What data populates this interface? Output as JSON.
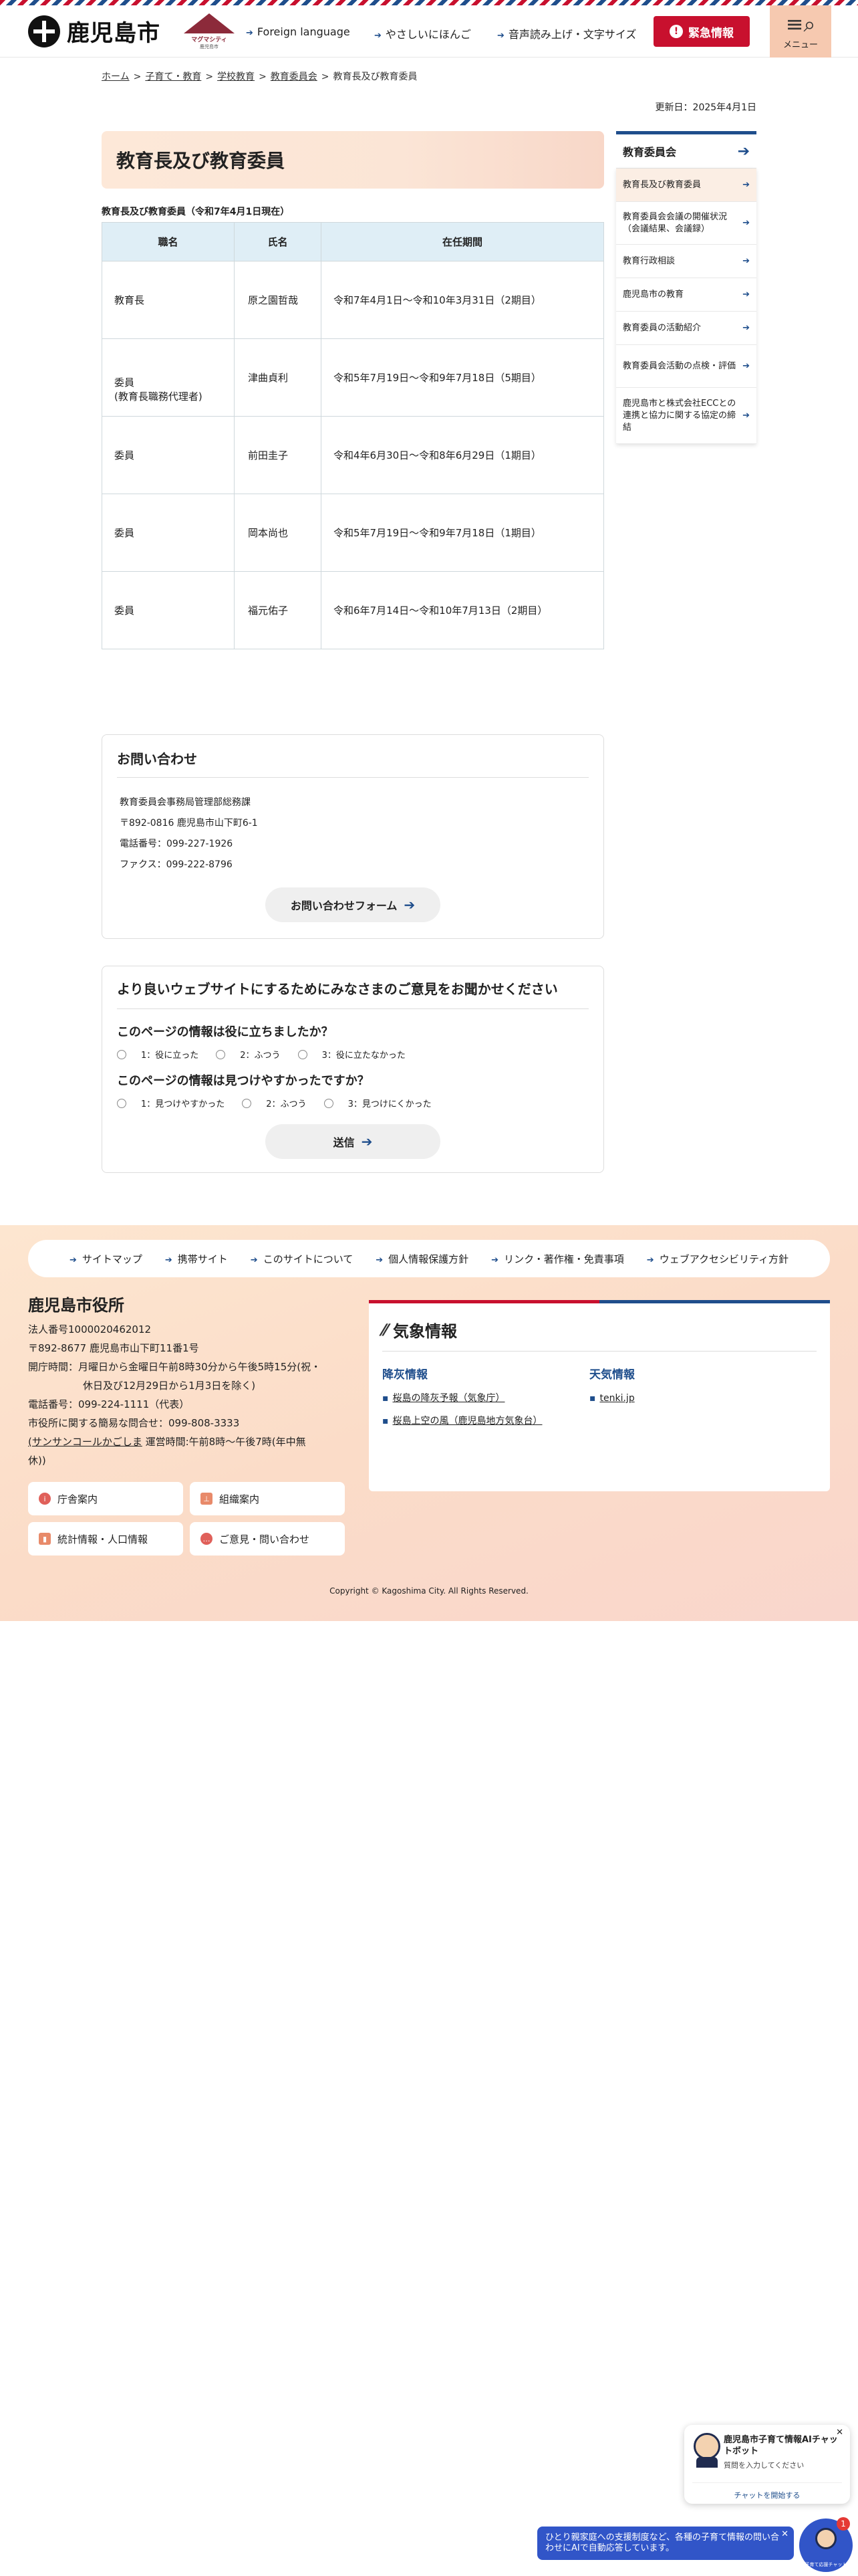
{
  "header": {
    "logo_text": "鹿児島市",
    "magma_text": "マグマシティ",
    "magma_sub": "鹿児島市",
    "nav": [
      "Foreign language",
      "やさしいにほんご",
      "音声読み上げ・文字サイズ"
    ],
    "emergency_label": "緊急情報",
    "menu_label": "メニュー"
  },
  "breadcrumb": [
    "ホーム",
    "子育て・教育",
    "学校教育",
    "教育委員会",
    "教育長及び教育委員"
  ],
  "updated": "更新日：2025年4月1日",
  "page_title": "教育長及び教育委員",
  "caption": "教育長及び教育委員（令和7年4月1日現在）",
  "table": {
    "headers": [
      "職名",
      "氏名",
      "在任期間"
    ],
    "rows": [
      {
        "position": "教育長",
        "position_sub": "",
        "name": "原之園哲哉",
        "term": "令和7年4月1日〜令和10年3月31日（2期目）"
      },
      {
        "position": "委員",
        "position_sub": "(教育長職務代理者)",
        "name": "津曲貞利",
        "term": "令和5年7月19日〜令和9年7月18日（5期目）"
      },
      {
        "position": "委員",
        "position_sub": "",
        "name": "前田圭子",
        "term": "令和4年6月30日〜令和8年6月29日（1期目）"
      },
      {
        "position": "委員",
        "position_sub": "",
        "name": "岡本尚也",
        "term": "令和5年7月19日〜令和9年7月18日（1期目）"
      },
      {
        "position": "委員",
        "position_sub": "",
        "name": "福元佑子",
        "term": "令和6年7月14日〜令和10年7月13日（2期目）"
      }
    ]
  },
  "sidebar": {
    "heading": "教育委員会",
    "items": [
      "教育長及び教育委員",
      "教育委員会会議の開催状況（会議結果、会議録）",
      "教育行政相談",
      "鹿児島市の教育",
      "教育委員の活動紹介",
      "教育委員会活動の点検・評価",
      "鹿児島市と株式会社ECCとの連携と協力に関する協定の締結"
    ]
  },
  "contact": {
    "heading": "お問い合わせ",
    "dept": "教育委員会事務局管理部総務課",
    "address": "〒892-0816 鹿児島市山下町6-1",
    "tel": "電話番号：099-227-1926",
    "fax": "ファクス：099-222-8796",
    "form_button": "お問い合わせフォーム"
  },
  "feedback": {
    "heading": "より良いウェブサイトにするためにみなさまのご意見をお聞かせください",
    "q1": "このページの情報は役に立ちましたか？",
    "q1_options": [
      "1：役に立った",
      "2：ふつう",
      "3：役に立たなかった"
    ],
    "q2": "このページの情報は見つけやすかったですか？",
    "q2_options": [
      "1：見つけやすかった",
      "2：ふつう",
      "3：見つけにくかった"
    ],
    "submit": "送信"
  },
  "footer": {
    "links": [
      "サイトマップ",
      "携帯サイト",
      "このサイトについて",
      "個人情報保護方針",
      "リンク・著作権・免責事項",
      "ウェブアクセシビリティ方針"
    ],
    "office_name": "鹿児島市役所",
    "corp_no": "法人番号1000020462012",
    "address": "〒892-8677 鹿児島市山下町11番1号",
    "hours_1": "開庁時間：月曜日から金曜日午前8時30分から午後5時15分(祝・",
    "hours_2": "休日及び12月29日から1月3日を除く)",
    "tel": "電話番号：099-224-1111（代表）",
    "inquiry": "市役所に関する簡易な問合せ：099-808-3333",
    "callcenter_link": "(サンサンコールかごしま",
    "callcenter_hours": " 運営時間:午前8時〜午後7時(年中無",
    "callcenter_end": "休))",
    "buttons": [
      "庁舎案内",
      "組織案内",
      "統計情報・人口情報",
      "ご意見・問い合わせ"
    ],
    "weather_heading": "気象情報",
    "ash_heading": "降灰情報",
    "ash_links": [
      "桜島の降灰予報（気象庁）",
      "桜島上空の風（鹿児島地方気象台）"
    ],
    "weather_sub": "天気情報",
    "weather_links": [
      "tenki.jp"
    ],
    "copyright": "Copyright © Kagoshima City. All Rights Reserved."
  },
  "chat": {
    "title": "鹿児島市子育て情報AIチャットボット",
    "subtitle": "質問を入力してください",
    "start": "チャットを開始する",
    "banner": "ひとり親家庭への支援制度など、各種の子育て情報の問い合わせにAIで自動応答しています。",
    "fab_label": "子育て応援チャット",
    "badge": "1"
  },
  "colors": {
    "accent": "#1f4e8c",
    "emergency": "#c8102e",
    "chat": "#3155c8"
  }
}
